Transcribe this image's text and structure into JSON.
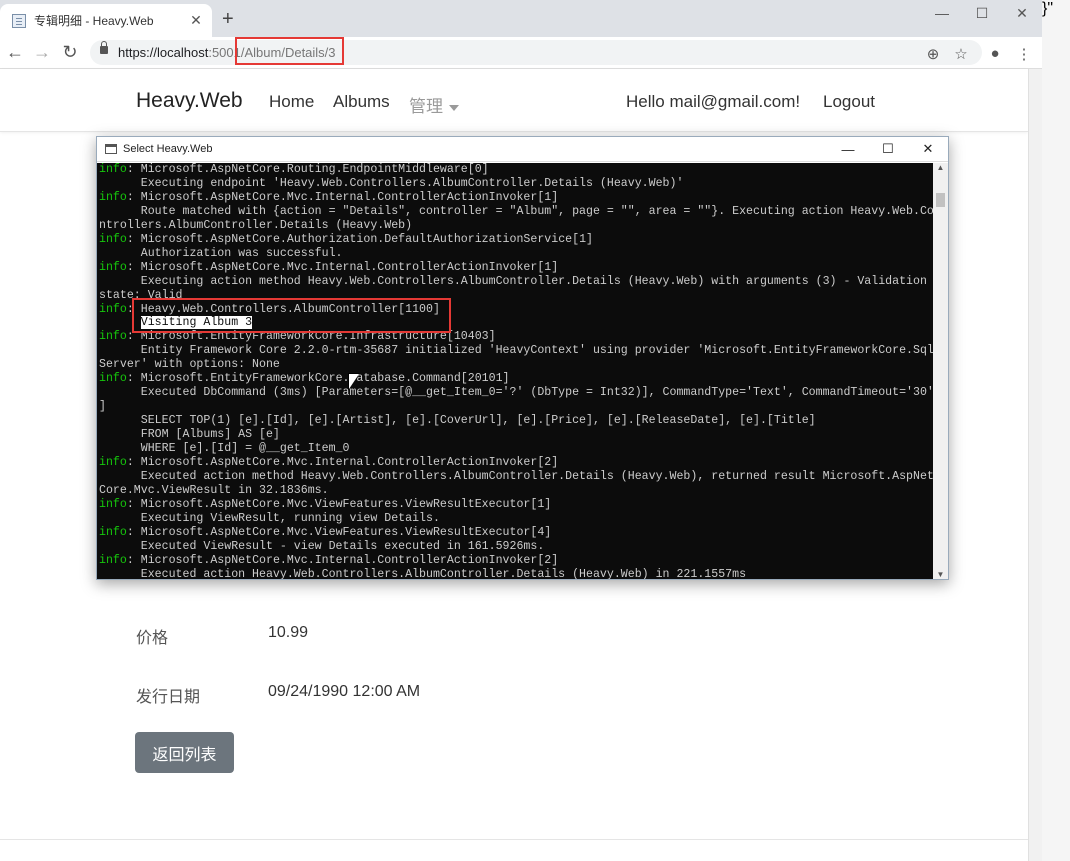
{
  "browser": {
    "tab_title": "专辑明细 - Heavy.Web",
    "tab_close": "✕",
    "new_tab": "+",
    "window_buttons": [
      "—",
      "☐",
      "✕"
    ],
    "nav": {
      "back": "←",
      "forward": "→",
      "reload": "↻"
    },
    "url_base": "https://localhost",
    "url_port": ":5001",
    "url_path": "/Album/Details/3",
    "toolbar_icons": {
      "zoom": "⊕",
      "star": "☆",
      "profile": "●",
      "menu": "⋮"
    }
  },
  "site": {
    "brand": "Heavy.Web",
    "nav": [
      "Home",
      "Albums",
      "管理"
    ],
    "greeting": "Hello mail@gmail.com!",
    "logout": "Logout"
  },
  "details": {
    "price_label": "价格",
    "price_value": "10.99",
    "release_label": "发行日期",
    "release_value": "09/24/1990 12:00 AM",
    "back_button": "返回列表"
  },
  "console": {
    "title": "Select Heavy.Web",
    "window_buttons": [
      "—",
      "☐",
      "✕"
    ],
    "lines": [
      [
        "info",
        ": Microsoft.AspNetCore.Routing.EndpointMiddleware[0]"
      ],
      [
        "",
        "      Executing endpoint 'Heavy.Web.Controllers.AlbumController.Details (Heavy.Web)'"
      ],
      [
        "info",
        ": Microsoft.AspNetCore.Mvc.Internal.ControllerActionInvoker[1]"
      ],
      [
        "",
        "      Route matched with {action = \"Details\", controller = \"Album\", page = \"\", area = \"\"}. Executing action Heavy.Web.Co"
      ],
      [
        "",
        "ntrollers.AlbumController.Details (Heavy.Web)"
      ],
      [
        "info",
        ": Microsoft.AspNetCore.Authorization.DefaultAuthorizationService[1]"
      ],
      [
        "",
        "      Authorization was successful."
      ],
      [
        "info",
        ": Microsoft.AspNetCore.Mvc.Internal.ControllerActionInvoker[1]"
      ],
      [
        "",
        "      Executing action method Heavy.Web.Controllers.AlbumController.Details (Heavy.Web) with arguments (3) - Validation"
      ],
      [
        "",
        "state: Valid"
      ],
      [
        "info",
        ": Heavy.Web.Controllers.AlbumController[1100]"
      ],
      [
        "hl",
        "Visiting Album 3"
      ],
      [
        "info",
        ": Microsoft.EntityFrameworkCore.Infrastructure[10403]"
      ],
      [
        "",
        "      Entity Framework Core 2.2.0-rtm-35687 initialized 'HeavyContext' using provider 'Microsoft.EntityFrameworkCore.Sql"
      ],
      [
        "",
        "Server' with options: None"
      ],
      [
        "info",
        ": Microsoft.EntityFrameworkCore.Database.Command[20101]"
      ],
      [
        "",
        "      Executed DbCommand (3ms) [Parameters=[@__get_Item_0='?' (DbType = Int32)], CommandType='Text', CommandTimeout='30'"
      ],
      [
        "",
        "]"
      ],
      [
        "",
        "      SELECT TOP(1) [e].[Id], [e].[Artist], [e].[CoverUrl], [e].[Price], [e].[ReleaseDate], [e].[Title]"
      ],
      [
        "",
        "      FROM [Albums] AS [e]"
      ],
      [
        "",
        "      WHERE [e].[Id] = @__get_Item_0"
      ],
      [
        "info",
        ": Microsoft.AspNetCore.Mvc.Internal.ControllerActionInvoker[2]"
      ],
      [
        "",
        "      Executed action method Heavy.Web.Controllers.AlbumController.Details (Heavy.Web), returned result Microsoft.AspNet"
      ],
      [
        "",
        "Core.Mvc.ViewResult in 32.1836ms."
      ],
      [
        "info",
        ": Microsoft.AspNetCore.Mvc.ViewFeatures.ViewResultExecutor[1]"
      ],
      [
        "",
        "      Executing ViewResult, running view Details."
      ],
      [
        "info",
        ": Microsoft.AspNetCore.Mvc.ViewFeatures.ViewResultExecutor[4]"
      ],
      [
        "",
        "      Executed ViewResult - view Details executed in 161.5926ms."
      ],
      [
        "info",
        ": Microsoft.AspNetCore.Mvc.Internal.ControllerActionInvoker[2]"
      ],
      [
        "",
        "      Executed action Heavy.Web.Controllers.AlbumController.Details (Heavy.Web) in 221.1557ms"
      ]
    ]
  },
  "background": {
    "code_fragment": "}\""
  },
  "colors": {
    "highlight_border": "#e53935",
    "console_bg": "#0c0c0c",
    "log_level": "#16c60c",
    "button_bg": "#6c757d"
  }
}
